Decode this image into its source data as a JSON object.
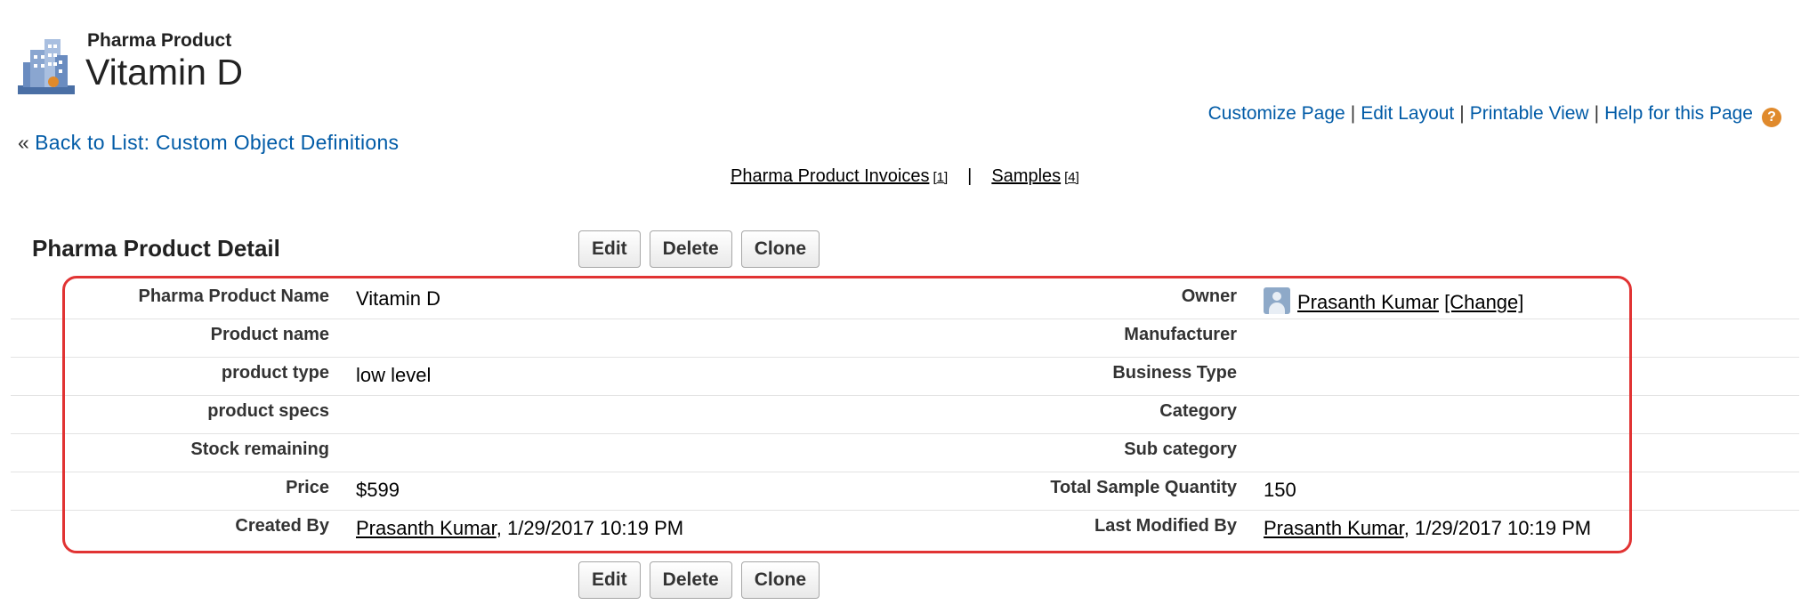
{
  "header": {
    "object_type": "Pharma Product",
    "record_title": "Vitamin D"
  },
  "top_links": [
    "Customize Page",
    "Edit Layout",
    "Printable View",
    "Help for this Page"
  ],
  "back_link": {
    "prefix": "«",
    "label": "Back to List: Custom Object Definitions"
  },
  "related_lists": [
    {
      "label": "Pharma Product Invoices",
      "count": "[1]"
    },
    {
      "label": "Samples",
      "count": "[4]"
    }
  ],
  "related_separator": "|",
  "section": {
    "title": "Pharma Product Detail",
    "buttons": {
      "edit": "Edit",
      "delete": "Delete",
      "clone": "Clone"
    }
  },
  "detail": {
    "rows": [
      {
        "left_label": "Pharma Product Name",
        "left_value": "Vitamin D",
        "right_label": "Owner",
        "right_value": "Prasanth Kumar",
        "right_extra": "[Change]"
      },
      {
        "left_label": "Product name",
        "left_value": "",
        "right_label": "Manufacturer",
        "right_value": ""
      },
      {
        "left_label": "product type",
        "left_value": "low level",
        "right_label": "Business Type",
        "right_value": ""
      },
      {
        "left_label": "product specs",
        "left_value": "",
        "right_label": "Category",
        "right_value": ""
      },
      {
        "left_label": "Stock remaining",
        "left_value": "",
        "right_label": "Sub category",
        "right_value": ""
      },
      {
        "left_label": "Price",
        "left_value": "$599",
        "right_label": "Total Sample Quantity",
        "right_value": "150"
      },
      {
        "left_label": "Created By",
        "left_user": "Prasanth Kumar",
        "left_date": ", 1/29/2017 10:19 PM",
        "right_label": "Last Modified By",
        "right_user": "Prasanth Kumar",
        "right_date": ", 1/29/2017 10:19 PM"
      }
    ]
  },
  "colors": {
    "link": "#015ba7",
    "highlight_border": "#e13333"
  }
}
